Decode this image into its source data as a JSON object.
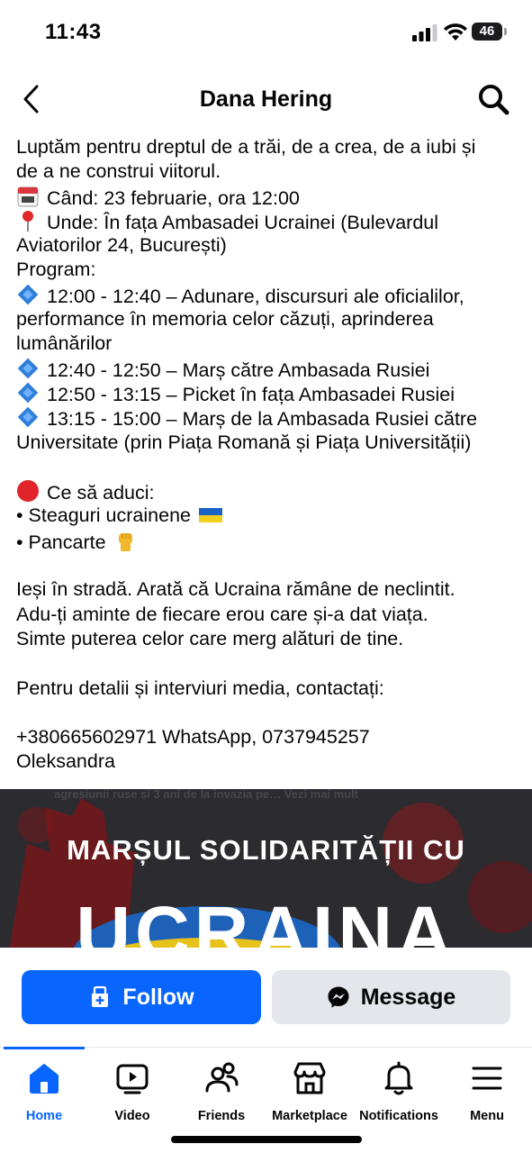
{
  "status_bar": {
    "time": "11:43",
    "battery": "46"
  },
  "header": {
    "title": "Dana Hering"
  },
  "post": {
    "lines": [
      {
        "text": "Luptăm pentru dreptul de a trăi, de a crea, de a iubi și"
      },
      {
        "text": "de a ne construi viitorul."
      },
      {
        "icon": "calendar-icon",
        "text": "Când: 23 februarie, ora 12:00"
      },
      {
        "icon": "pin-icon",
        "text": "Unde: În fața Ambasadei Ucrainei (Bulevardul"
      },
      {
        "text": "Aviatorilor 24, București)"
      },
      {
        "text": "Program:"
      },
      {
        "icon": "blue-diamond-icon",
        "text": "12:00 - 12:40 – Adunare, discursuri ale oficialilor,"
      },
      {
        "text": "performance în memoria celor căzuți, aprinderea"
      },
      {
        "text": "lumânărilor"
      },
      {
        "icon": "blue-diamond-icon",
        "text": "12:40 - 12:50 – Marș către Ambasada Rusiei"
      },
      {
        "icon": "blue-diamond-icon",
        "text": "12:50 - 13:15 – Picket în fața Ambasadei Rusiei"
      },
      {
        "icon": "blue-diamond-icon",
        "text": "13:15 - 15:00 – Marș de la Ambasada Rusiei către"
      },
      {
        "text": "Universitate (prin Piața Romană și Piața Universității)"
      },
      {
        "blank": true
      },
      {
        "icon": "red-circle-icon",
        "text": "Ce să aduci:"
      },
      {
        "text": " • Steaguri ucrainene",
        "icon_after": "ukraine-flag-icon"
      },
      {
        "text": " • Pancarte",
        "icon_after": "raised-fist-icon"
      },
      {
        "blank": true
      },
      {
        "text": "Ieși în stradă. Arată că Ucraina rămâne de neclintit."
      },
      {
        "text": "Adu-ți aminte de fiecare erou care și-a dat viața."
      },
      {
        "text": "Simte puterea celor care merg alături de tine."
      },
      {
        "blank": true
      },
      {
        "text": "Pentru detalii și interviuri media, contactați:"
      },
      {
        "blank": true
      },
      {
        "text": "+380665602971 WhatsApp, 0737945257"
      },
      {
        "text": "Oleksandra"
      }
    ]
  },
  "event_image": {
    "top_text": "agresiunii ruse și 3 ani de la invazia pe… Vezi mai mult",
    "title_line1": "MARȘUL SOLIDARITĂȚII CU",
    "title_line2": "UCRAINA"
  },
  "actions": {
    "follow_label": "Follow",
    "message_label": "Message"
  },
  "tabs": [
    {
      "id": "home",
      "label": "Home",
      "active": true
    },
    {
      "id": "video",
      "label": "Video"
    },
    {
      "id": "friends",
      "label": "Friends"
    },
    {
      "id": "marketplace",
      "label": "Marketplace"
    },
    {
      "id": "notifications",
      "label": "Notifications"
    },
    {
      "id": "menu",
      "label": "Menu"
    }
  ],
  "colors": {
    "accent": "#0866ff",
    "button_gray": "#e4e6eb",
    "text": "#050505"
  }
}
